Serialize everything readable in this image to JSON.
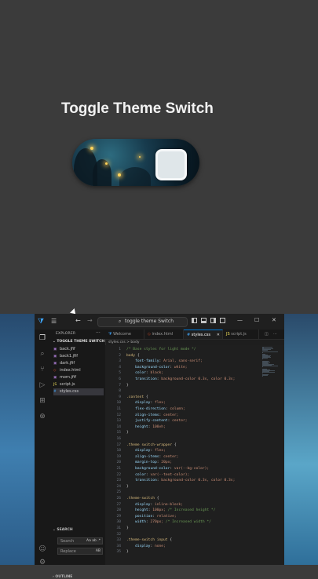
{
  "preview": {
    "title": "Toggle Theme Switch"
  },
  "vscode": {
    "search_text": "toggle theme Switch",
    "sidebar": {
      "title": "EXPLORER",
      "folder": "TOGGLE THEME SWITCH",
      "files": [
        {
          "name": "back.jfif",
          "icon": "image-file-icon",
          "active": false
        },
        {
          "name": "back1.jfif",
          "icon": "image-file-icon",
          "active": false
        },
        {
          "name": "dark.jfif",
          "icon": "image-file-icon",
          "active": false
        },
        {
          "name": "index.html",
          "icon": "html-file-icon",
          "active": false
        },
        {
          "name": "morn.jfif",
          "icon": "image-file-icon",
          "active": false
        },
        {
          "name": "script.js",
          "icon": "js-file-icon",
          "active": false
        },
        {
          "name": "styles.css",
          "icon": "css-file-icon",
          "active": true
        }
      ],
      "search_label": "SEARCH",
      "search_placeholder": "Search",
      "search_opts": "Aa ab .*",
      "replace_placeholder": "Replace",
      "replace_opts": "AB",
      "outline_label": "OUTLINE"
    },
    "tabs": [
      {
        "label": "Welcome",
        "active": false
      },
      {
        "label": "index.html",
        "active": false
      },
      {
        "label": "styles.css",
        "active": true
      },
      {
        "label": "script.js",
        "active": false
      }
    ],
    "breadcrumb": "styles.css > body",
    "code": [
      {
        "n": "1",
        "t": "/* Base styles for light mode */"
      },
      {
        "n": "2",
        "t": "body {"
      },
      {
        "n": "3",
        "t": "    font-family: Arial, sans-serif;"
      },
      {
        "n": "4",
        "t": "    background-color: white;"
      },
      {
        "n": "5",
        "t": "    color: black;"
      },
      {
        "n": "6",
        "t": "    transition: background-color 0.3s, color 0.3s;"
      },
      {
        "n": "7",
        "t": "}"
      },
      {
        "n": "8",
        "t": ""
      },
      {
        "n": "9",
        "t": ".content {"
      },
      {
        "n": "10",
        "t": "    display: flex;"
      },
      {
        "n": "11",
        "t": "    flex-direction: column;"
      },
      {
        "n": "12",
        "t": "    align-items: center;"
      },
      {
        "n": "13",
        "t": "    justify-content: center;"
      },
      {
        "n": "14",
        "t": "    height: 100vh;"
      },
      {
        "n": "15",
        "t": "}"
      },
      {
        "n": "16",
        "t": ""
      },
      {
        "n": "17",
        "t": ".theme switch-wrapper {"
      },
      {
        "n": "18",
        "t": "    display: flex;"
      },
      {
        "n": "19",
        "t": "    align-items: center;"
      },
      {
        "n": "20",
        "t": "    margin-top: 20px;"
      },
      {
        "n": "21",
        "t": "    background-color: var(--bg-color);"
      },
      {
        "n": "22",
        "t": "    color: var(--text-color);"
      },
      {
        "n": "23",
        "t": "    transition: background-color 0.3s, color 0.3s;"
      },
      {
        "n": "24",
        "t": "}"
      },
      {
        "n": "25",
        "t": ""
      },
      {
        "n": "26",
        "t": ".theme-switch {"
      },
      {
        "n": "27",
        "t": "    display: inline-block;"
      },
      {
        "n": "28",
        "t": "    height: 100px; /* Increased height */"
      },
      {
        "n": "29",
        "t": "    position: relative;"
      },
      {
        "n": "30",
        "t": "    width: 270px; /* Increased width */"
      },
      {
        "n": "31",
        "t": "}"
      },
      {
        "n": "32",
        "t": ""
      },
      {
        "n": "33",
        "t": ".theme-switch input {"
      },
      {
        "n": "34",
        "t": "    display: none;"
      },
      {
        "n": "35",
        "t": "}"
      }
    ],
    "colors": {
      "accent": "#0078d4",
      "editor_bg": "#1f1f1f",
      "comment": "#6a9955",
      "selector": "#d7ba7d",
      "property": "#9cdcfe",
      "value": "#ce9178"
    }
  }
}
